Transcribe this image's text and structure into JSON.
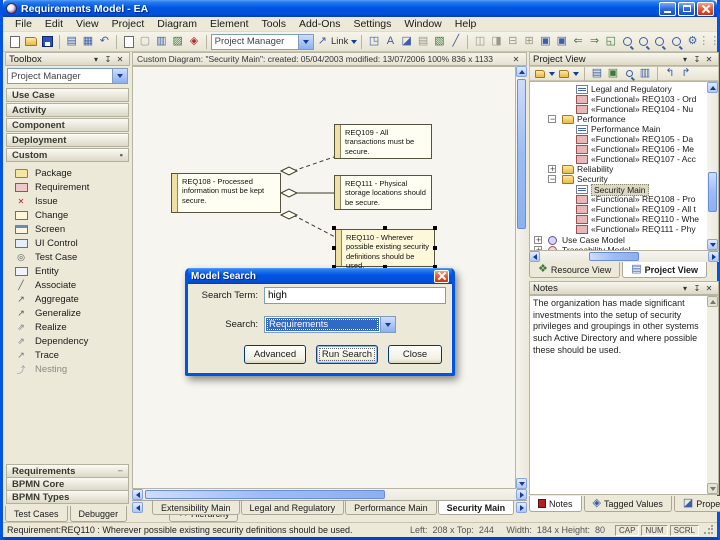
{
  "window": {
    "title": "Requirements Model - EA"
  },
  "menu": {
    "items": [
      "File",
      "Edit",
      "View",
      "Project",
      "Diagram",
      "Element",
      "Tools",
      "Add-Ons",
      "Settings",
      "Window",
      "Help"
    ]
  },
  "toolbar": {
    "project_combo": "Project Manager",
    "link_label": "Link"
  },
  "toolbox": {
    "title": "Toolbox",
    "combo": "Project Manager",
    "sections": [
      "Use Case",
      "Activity",
      "Component",
      "Deployment",
      "Custom"
    ],
    "items": [
      "Package",
      "Requirement",
      "Issue",
      "Change",
      "Screen",
      "UI Control",
      "Test Case",
      "Entity",
      "Associate",
      "Aggregate",
      "Generalize",
      "Realize",
      "Dependency",
      "Trace",
      "Nesting"
    ],
    "lower_sections": [
      "Requirements",
      "BPMN Core",
      "BPMN Types"
    ],
    "bottom_tabs": [
      "Test Cases",
      "Debugger",
      "Hierarchy"
    ]
  },
  "diagram": {
    "header": "Custom Diagram: \"Security Main\": created: 05/04/2003 modified: 13/07/2006  100%  836 x 1133",
    "tabs": [
      "Extensibility Main",
      "Legal and Regulatory",
      "Performance Main",
      "Security Main"
    ],
    "boxes": [
      {
        "id": "REQ109",
        "text": "REQ109 - All transactions must be secure."
      },
      {
        "id": "REQ108",
        "text": "REQ108 - Processed information must be kept secure."
      },
      {
        "id": "REQ111",
        "text": "REQ111 - Physical storage locations should be secure."
      },
      {
        "id": "REQ110",
        "text": "REQ110 - Wherever possible existing security definitions should be used."
      }
    ]
  },
  "search_dialog": {
    "title": "Model Search",
    "search_term_label": "Search Term:",
    "search_term_value": "high",
    "search_label": "Search:",
    "search_value": "Requirements",
    "buttons": [
      "Advanced",
      "Run Search",
      "Close"
    ]
  },
  "project_view": {
    "title": "Project View",
    "tree": [
      "Legal and Regulatory",
      "«Functional» REQ103 - Ord",
      "«Functional» REQ104 - Nu",
      "Performance",
      "Performance Main",
      "«Functional» REQ105 - Da",
      "«Functional» REQ106 - Me",
      "«Functional» REQ107 - Acc",
      "Reliability",
      "Security",
      "Security Main",
      "«Functional» REQ108 - Pro",
      "«Functional» REQ109 - All t",
      "«Functional» REQ110 - Whe",
      "«Functional» REQ111 - Phy",
      "Use Case Model",
      "Traceability Model"
    ],
    "tabs": [
      "Resource View",
      "Project View"
    ]
  },
  "notes": {
    "title": "Notes",
    "text": "The organization has made significant investments into the setup of security privileges and groupings in other systems such Active Directory and where possible these should be used.",
    "tabs": [
      "Notes",
      "Tagged Values",
      "Properties"
    ]
  },
  "status": {
    "message": "Requirement:REQ110 : Wherever possible existing security definitions should be used.",
    "position": "Left:  208 x Top:  244     Width:  184 x Height:  80",
    "flags": [
      "CAP",
      "NUM",
      "SCRL"
    ]
  }
}
